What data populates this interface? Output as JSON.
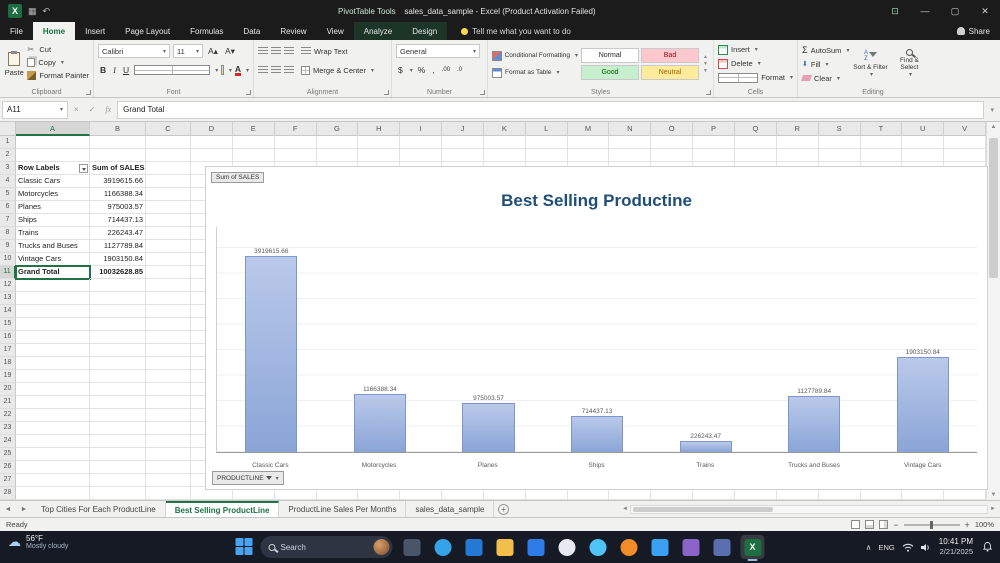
{
  "titlebar": {
    "context_label": "PivotTable Tools",
    "title": "sales_data_sample - Excel (Product Activation Failed)",
    "minimize": "—",
    "maximize": "▢",
    "close": "✕"
  },
  "ribbon": {
    "tabs": [
      {
        "label": "File"
      },
      {
        "label": "Home",
        "active": true
      },
      {
        "label": "Insert"
      },
      {
        "label": "Page Layout"
      },
      {
        "label": "Formulas"
      },
      {
        "label": "Data"
      },
      {
        "label": "Review"
      },
      {
        "label": "View"
      },
      {
        "label": "Analyze",
        "contextual": true
      },
      {
        "label": "Design",
        "contextual": true
      }
    ],
    "tell_me": "Tell me what you want to do",
    "share_label": "Share",
    "clipboard": {
      "label": "Clipboard",
      "paste": "Paste",
      "cut": "Cut",
      "copy": "Copy",
      "format_painter": "Format Painter"
    },
    "font": {
      "label": "Font",
      "family": "Calibri",
      "size": "11",
      "bold": "B",
      "italic": "I",
      "underline": "U"
    },
    "alignment": {
      "label": "Alignment",
      "wrap_text": "Wrap Text",
      "merge_center": "Merge & Center"
    },
    "number": {
      "label": "Number",
      "format": "General",
      "currency": "$",
      "percent": "%",
      "comma": ","
    },
    "styles": {
      "label": "Styles",
      "conditional": "Conditional Formatting",
      "format_table": "Format as Table",
      "gallery": [
        "Normal",
        "Bad",
        "Good",
        "Neutral"
      ]
    },
    "cells": {
      "label": "Cells",
      "insert": "Insert",
      "delete": "Delete",
      "format": "Format"
    },
    "editing": {
      "label": "Editing",
      "autosum": "AutoSum",
      "fill": "Fill",
      "clear": "Clear",
      "sort_filter": "Sort & Filter",
      "find_select": "Find & Select"
    }
  },
  "formula_bar": {
    "name_box": "A11",
    "content": "Grand Total"
  },
  "sheet": {
    "columns": [
      "A",
      "B",
      "C",
      "D",
      "E",
      "F",
      "G",
      "H",
      "I",
      "J",
      "K",
      "L",
      "M",
      "N",
      "O",
      "P",
      "Q",
      "R",
      "S",
      "T",
      "U",
      "V"
    ],
    "rows": 28,
    "selected": {
      "col": "A",
      "row": 11
    },
    "cells": [
      {
        "col": "A",
        "row": 3,
        "text": "Row Labels",
        "bold": true,
        "filter": true
      },
      {
        "col": "B",
        "row": 3,
        "text": "Sum of SALES",
        "bold": true
      },
      {
        "col": "A",
        "row": 4,
        "text": "Classic Cars"
      },
      {
        "col": "B",
        "row": 4,
        "text": "3919615.66",
        "num": true
      },
      {
        "col": "A",
        "row": 5,
        "text": "Motorcycles"
      },
      {
        "col": "B",
        "row": 5,
        "text": "1166388.34",
        "num": true
      },
      {
        "col": "A",
        "row": 6,
        "text": "Planes"
      },
      {
        "col": "B",
        "row": 6,
        "text": "975003.57",
        "num": true
      },
      {
        "col": "A",
        "row": 7,
        "text": "Ships"
      },
      {
        "col": "B",
        "row": 7,
        "text": "714437.13",
        "num": true
      },
      {
        "col": "A",
        "row": 8,
        "text": "Trains"
      },
      {
        "col": "B",
        "row": 8,
        "text": "226243.47",
        "num": true
      },
      {
        "col": "A",
        "row": 9,
        "text": "Trucks and Buses"
      },
      {
        "col": "B",
        "row": 9,
        "text": "1127789.84",
        "num": true
      },
      {
        "col": "A",
        "row": 10,
        "text": "Vintage Cars"
      },
      {
        "col": "B",
        "row": 10,
        "text": "1903150.84",
        "num": true
      },
      {
        "col": "A",
        "row": 11,
        "text": "Grand Total",
        "bold": true,
        "selected": true
      },
      {
        "col": "B",
        "row": 11,
        "text": "10032628.85",
        "num": true,
        "bold": true
      }
    ]
  },
  "chart_data": {
    "type": "bar",
    "title": "Best Selling Productine",
    "categories": [
      "Classic Cars",
      "Motorcycles",
      "Planes",
      "Ships",
      "Trains",
      "Trucks and Buses",
      "Vintage Cars"
    ],
    "values": [
      3919615.66,
      1166388.34,
      975003.57,
      714437.13,
      226243.47,
      1127789.84,
      1903150.84
    ],
    "labels": [
      "3919615.66",
      "1166388.34",
      "975003.57",
      "714437.13",
      "226243.47",
      "1127789.84",
      "1903150.84"
    ],
    "value_field_button": "Sum of SALES",
    "axis_field_button": "PRODUCTLINE",
    "ylim": [
      0,
      4500000
    ],
    "gridlines": true,
    "legend": "none",
    "bar_color": "#8aa5d6",
    "title_color": "#1f4e79"
  },
  "sheet_tabs": {
    "tabs": [
      {
        "label": "Top Cities For Each ProductLine"
      },
      {
        "label": "Best Selling ProductLine",
        "active": true
      },
      {
        "label": "ProductLine Sales Per Months"
      },
      {
        "label": "sales_data_sample"
      }
    ]
  },
  "status_bar": {
    "ready": "Ready",
    "zoom": "100%"
  },
  "taskbar": {
    "weather": {
      "temp": "56°F",
      "condition": "Mostly cloudy"
    },
    "search_label": "Search",
    "apps": [
      {
        "name": "task-view",
        "color": "#4a5568",
        "shape": "square"
      },
      {
        "name": "edge",
        "color": "#35a3e8",
        "shape": "circle"
      },
      {
        "name": "outlook",
        "color": "#2479d6",
        "shape": "square"
      },
      {
        "name": "file-explorer",
        "color": "#f2c04a",
        "shape": "square"
      },
      {
        "name": "store",
        "color": "#2e7ce8",
        "shape": "square"
      },
      {
        "name": "photos",
        "color": "#e7eaf2",
        "shape": "circle"
      },
      {
        "name": "edge-dev",
        "color": "#4fc3f7",
        "shape": "circle"
      },
      {
        "name": "firefox",
        "color": "#f28c28",
        "shape": "circle"
      },
      {
        "name": "vscode",
        "color": "#3aa0f3",
        "shape": "square"
      },
      {
        "name": "visual-studio",
        "color": "#8a63c9",
        "shape": "square"
      },
      {
        "name": "discord",
        "color": "#5b6eae",
        "shape": "square"
      },
      {
        "name": "excel",
        "color": "#1d6f42",
        "shape": "square",
        "glyph": "X",
        "active": true
      }
    ],
    "tray": {
      "lang": "ENG",
      "time": "10:41 PM",
      "date": "2/21/2025"
    }
  }
}
